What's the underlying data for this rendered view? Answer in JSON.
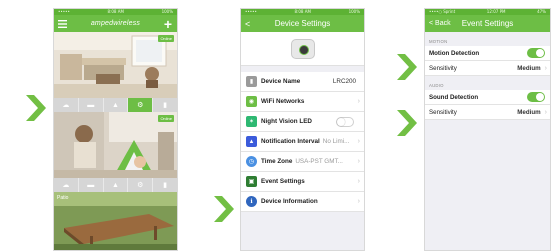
{
  "colors": {
    "accent": "#6dbe45",
    "arrow": "#72bf44"
  },
  "phone1": {
    "status": {
      "left": "•••••",
      "time": "8:08 AM",
      "battery": "100%"
    },
    "nav": {
      "menu_icon": "menu-icon",
      "logo_main": "ampedwireless",
      "add_icon": "plus-icon"
    },
    "cameras": [
      {
        "badge": "Online",
        "label": ""
      },
      {
        "badge": "Online",
        "label": ""
      },
      {
        "badge": "",
        "label": "Patio"
      }
    ],
    "toolbar": [
      {
        "icon": "cloud-icon",
        "glyph": "☁"
      },
      {
        "icon": "video-icon",
        "glyph": "▬"
      },
      {
        "icon": "image-icon",
        "glyph": "▲"
      },
      {
        "icon": "gear-icon",
        "glyph": "⚙"
      },
      {
        "icon": "trash-icon",
        "glyph": "▮"
      }
    ]
  },
  "phone2": {
    "status": {
      "left": "•••••",
      "time": "8:08 AM",
      "battery": "100%"
    },
    "nav": {
      "back": "<",
      "title": "Device Settings"
    },
    "rows": [
      {
        "label": "Device Name",
        "value": "LRC200",
        "icon_color": "#9a9a9a",
        "glyph": "▮"
      },
      {
        "label": "WiFi Networks",
        "value": "",
        "icon_color": "#6dbe45",
        "glyph": "◉"
      },
      {
        "label": "Night Vision LED",
        "value": "",
        "icon_color": "#2eb872",
        "glyph": "✶"
      },
      {
        "label": "Notification Interval",
        "value": "No Limi...",
        "icon_color": "#3b5bdb",
        "glyph": "▲"
      },
      {
        "label": "Time Zone",
        "value": "USA-PST GMT...",
        "icon_color": "#4a90e2",
        "glyph": "◷"
      },
      {
        "label": "Event Settings",
        "value": "",
        "icon_color": "#2e7d32",
        "glyph": "▣"
      },
      {
        "label": "Device Information",
        "value": "",
        "icon_color": "#3066be",
        "glyph": "ℹ"
      }
    ]
  },
  "phone3": {
    "status": {
      "left": "••••○ Sprint",
      "time": "12:07 PM",
      "battery": "47%"
    },
    "nav": {
      "back": "< Back",
      "title": "Event Settings"
    },
    "motion": {
      "header": "MOTION",
      "detection_label": "Motion Detection",
      "sensitivity_label": "Sensitivity",
      "sensitivity_value": "Medium"
    },
    "audio": {
      "header": "AUDIO",
      "detection_label": "Sound Detection",
      "sensitivity_label": "Sensitivity",
      "sensitivity_value": "Medium"
    }
  }
}
